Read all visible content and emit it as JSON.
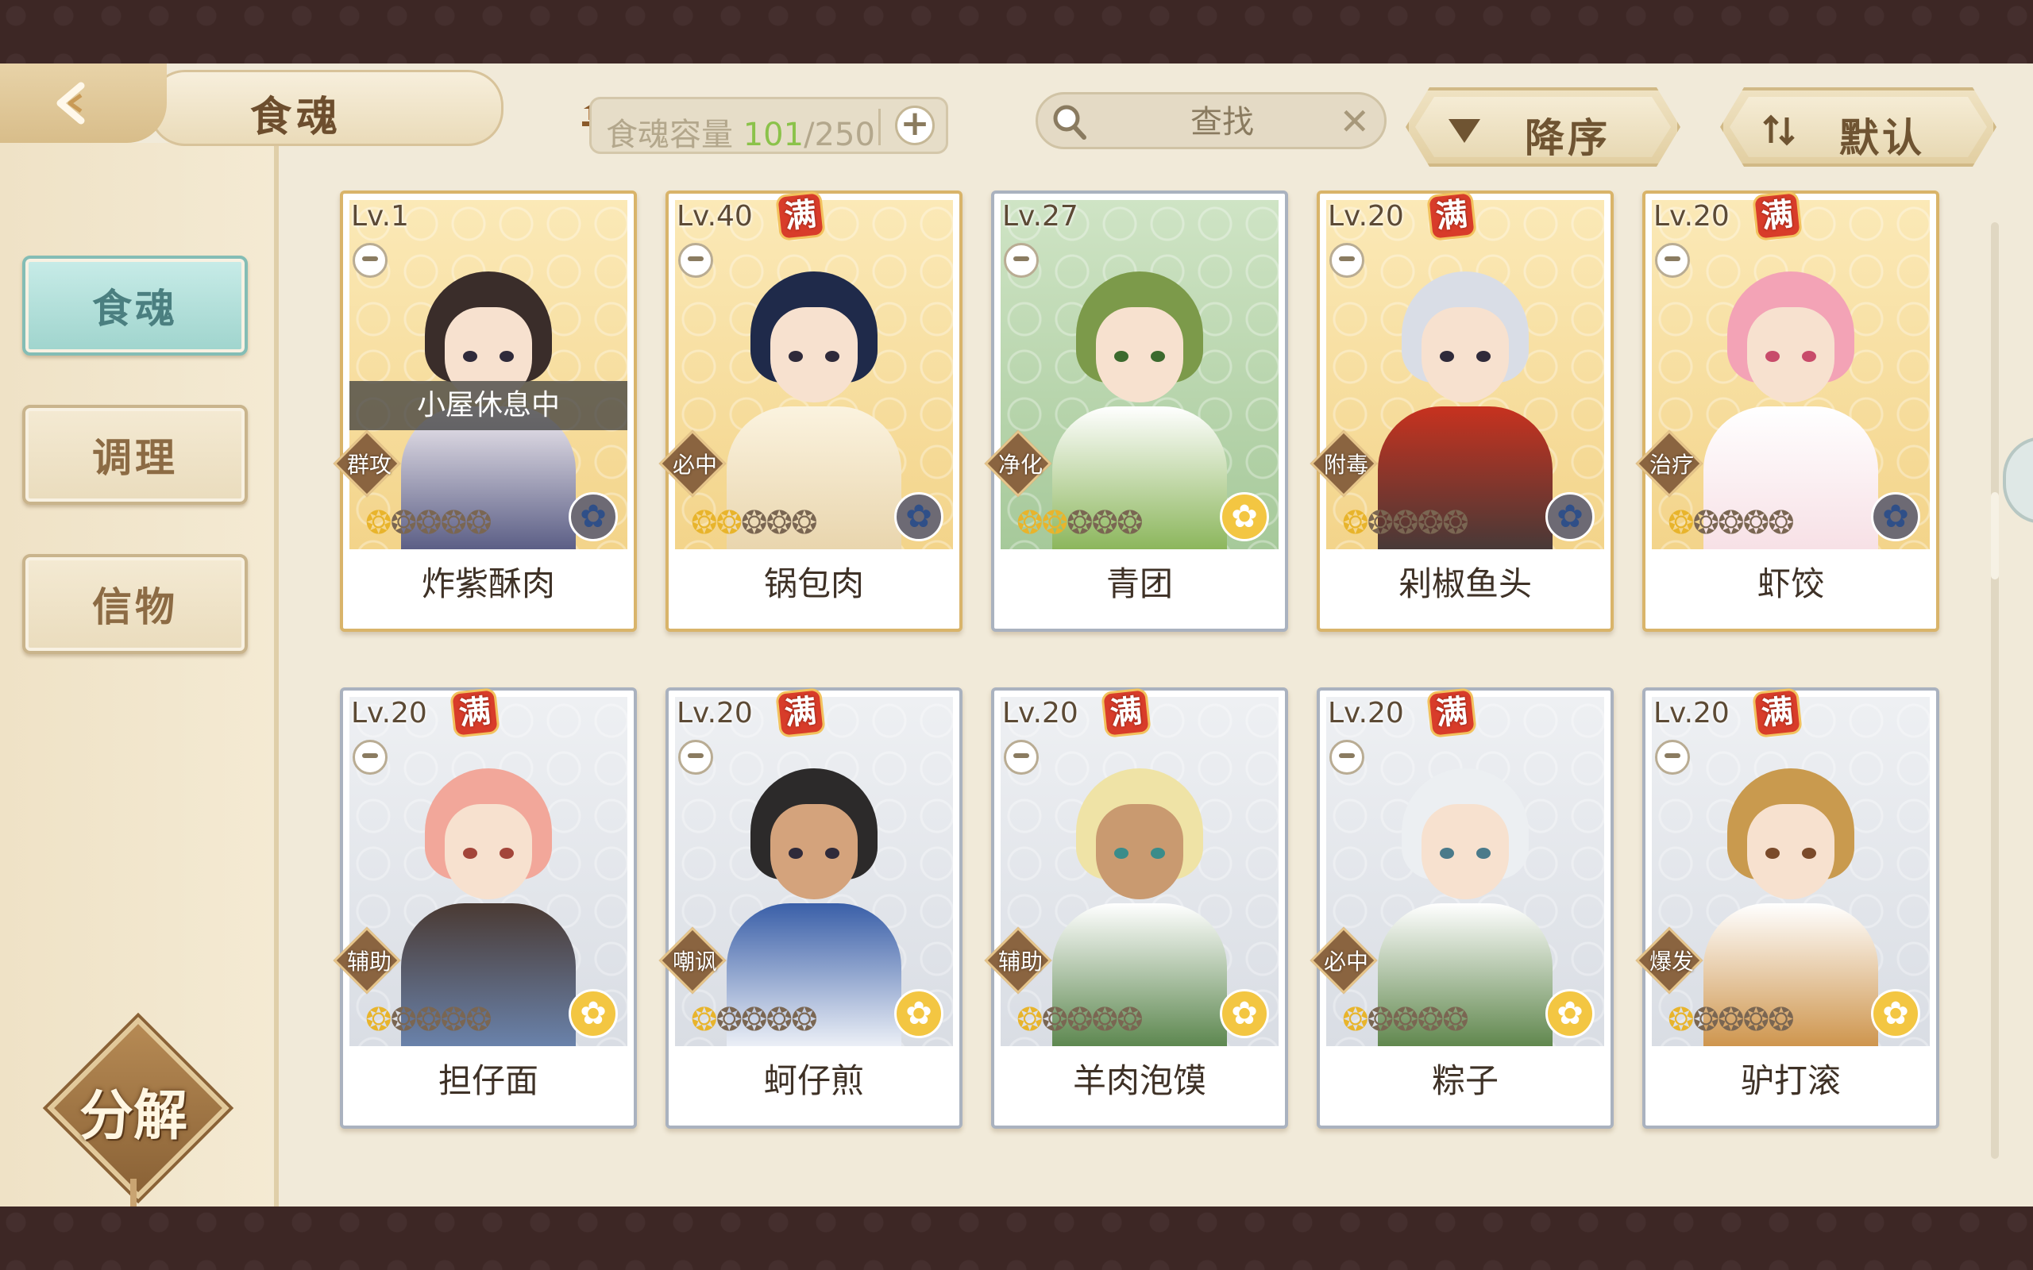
{
  "header": {
    "title": "食魂",
    "capacity_label": "食魂容量",
    "capacity_current": "101",
    "capacity_total": "/250",
    "search_placeholder": "查找",
    "sort_order_label": "降序",
    "sort_mode_label": "默认"
  },
  "sidebar": {
    "items": [
      {
        "label": "食魂",
        "active": true
      },
      {
        "label": "调理",
        "active": false
      },
      {
        "label": "信物",
        "active": false
      }
    ],
    "decompose_label": "分解"
  },
  "colors": {
    "accent_teal": "#9fd4cd",
    "capacity_green": "#8bc24a",
    "max_badge_red": "#d83c2a",
    "star_gold": "#e8b42c"
  },
  "cards": [
    {
      "level": "Lv.1",
      "max": "",
      "role": "群攻",
      "stars": 1,
      "name": "炸紫酥肉",
      "status": "小屋休息中",
      "emblem": "blue-flower-icon"
    },
    {
      "level": "Lv.40",
      "max": "满",
      "role": "必中",
      "stars": 2,
      "name": "锅包肉",
      "status": "",
      "emblem": "blue-flower-icon"
    },
    {
      "level": "Lv.27",
      "max": "",
      "role": "净化",
      "stars": 2,
      "name": "青团",
      "status": "",
      "emblem": "gold-flower-icon"
    },
    {
      "level": "Lv.20",
      "max": "满",
      "role": "附毒",
      "stars": 1,
      "name": "剁椒鱼头",
      "status": "",
      "emblem": "blue-flower-icon"
    },
    {
      "level": "Lv.20",
      "max": "满",
      "role": "治疗",
      "stars": 1,
      "name": "虾饺",
      "status": "",
      "emblem": "blue-flower-icon"
    },
    {
      "level": "Lv.20",
      "max": "满",
      "role": "辅助",
      "stars": 1,
      "name": "担仔面",
      "status": "",
      "emblem": "gold-flower-icon"
    },
    {
      "level": "Lv.20",
      "max": "满",
      "role": "嘲讽",
      "stars": 1,
      "name": "蚵仔煎",
      "status": "",
      "emblem": "gold-flower-icon"
    },
    {
      "level": "Lv.20",
      "max": "满",
      "role": "辅助",
      "stars": 1,
      "name": "羊肉泡馍",
      "status": "",
      "emblem": "gold-flower-icon"
    },
    {
      "level": "Lv.20",
      "max": "满",
      "role": "必中",
      "stars": 1,
      "name": "粽子",
      "status": "",
      "emblem": "gold-flower-icon"
    },
    {
      "level": "Lv.20",
      "max": "满",
      "role": "爆发",
      "stars": 1,
      "name": "驴打滚",
      "status": "",
      "emblem": "gold-flower-icon"
    }
  ]
}
